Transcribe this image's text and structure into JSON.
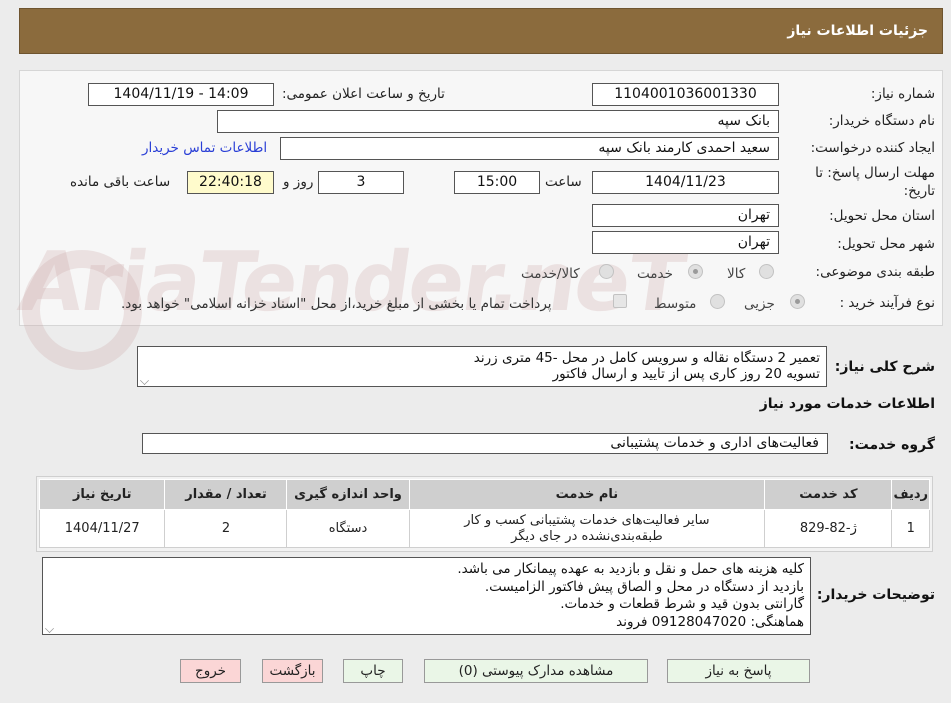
{
  "header": {
    "title": "جزئیات اطلاعات نیاز"
  },
  "watermark": {
    "text": "AriaTender.neT"
  },
  "fields": {
    "need_number_label": "شماره نیاز:",
    "need_number": "1104001036001330",
    "announce_label": "تاریخ و ساعت اعلان عمومی:",
    "announce_value": "1404/11/19 - 14:09",
    "buyer_org_label": "نام دستگاه خریدار:",
    "buyer_org": "بانک سپه",
    "creator_label": "ایجاد کننده درخواست:",
    "creator": "سعید احمدی کارمند بانک سپه",
    "contact_link": "اطلاعات تماس خریدار",
    "deadline_label_1": "مهلت ارسال پاسخ: تا",
    "deadline_label_2": "تاریخ:",
    "deadline_date": "1404/11/23",
    "time_label": "ساعت",
    "deadline_time": "15:00",
    "days_value": "3",
    "days_label": "روز و",
    "remaining_time": "22:40:18",
    "remaining_label": "ساعت باقی مانده",
    "province_label": "استان محل تحویل:",
    "province": "تهران",
    "city_label": "شهر محل تحویل:",
    "city": "تهران",
    "category_label": "طبقه بندی موضوعی:",
    "category_options": [
      "کالا",
      "خدمت",
      "کالا/خدمت"
    ],
    "category_selected": "خدمت",
    "process_label": "نوع فرآیند خرید :",
    "process_options": [
      "جزیی",
      "متوسط"
    ],
    "process_selected": "جزیی",
    "payment_note": "پرداخت تمام یا بخشی از مبلغ خرید،از محل \"اسناد خزانه اسلامی\" خواهد بود."
  },
  "description": {
    "label": "شرح کلی نیاز:",
    "lines": [
      "تعمیر 2 دستگاه نقاله و سرویس کامل در محل -45 متری زرند",
      "تسویه 20 روز کاری پس از تایید و ارسال فاکتور"
    ]
  },
  "services": {
    "section_title": "اطلاعات خدمات مورد نیاز",
    "group_label": "گروه خدمت:",
    "group_value": "فعالیت‌های اداری و خدمات پشتیبانی",
    "columns": [
      "ردیف",
      "کد خدمت",
      "نام خدمت",
      "واحد اندازه گیری",
      "تعداد / مقدار",
      "تاریخ نیاز"
    ],
    "rows": [
      {
        "row": "1",
        "code": "ژ-82-829",
        "name_line1": "سایر فعالیت‌های خدمات پشتیبانی کسب و کار",
        "name_line2": "طبقه‌بندی‌نشده در جای دیگر",
        "unit": "دستگاه",
        "qty": "2",
        "date": "1404/11/27"
      }
    ]
  },
  "buyer_notes": {
    "label": "توضیحات خریدار:",
    "lines": [
      "کلیه هزینه های حمل و نقل و بازدید به عهده پیمانکار می باشد.",
      "بازدید از دستگاه در محل و الصاق پیش فاکتور الزامیست.",
      "گارانتی بدون قید و شرط قطعات و خدمات.",
      "هماهنگی: 09128047020 فروند"
    ]
  },
  "buttons": {
    "reply": "پاسخ به نیاز",
    "attachments": "مشاهده مدارک پیوستی (0)",
    "print": "چاپ",
    "back": "بازگشت",
    "exit": "خروج"
  }
}
